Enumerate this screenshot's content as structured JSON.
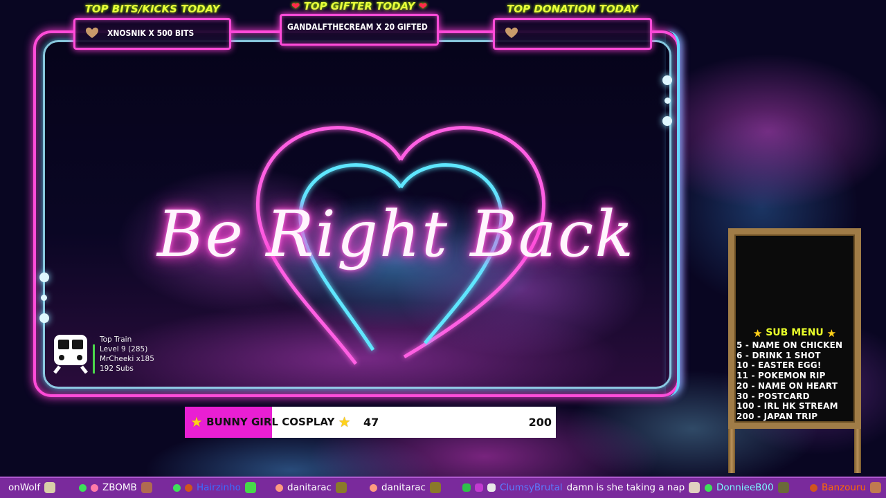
{
  "top_boxes": [
    {
      "heading": "TOP BITS/KICKS TODAY",
      "value": "XNOSNIK X 500 BITS"
    },
    {
      "heading": "TOP GIFTER TODAY",
      "value": "GANDALFTHECREAM X 20 GIFTED"
    },
    {
      "heading": "TOP DONATION TODAY",
      "value": ""
    }
  ],
  "main": {
    "title": "Be Right Back"
  },
  "train": {
    "label": "Top Train",
    "level": "Level 9  (285)",
    "user": "MrCheeki x185",
    "subs": "192 Subs"
  },
  "goal": {
    "label": "BUNNY GIRL COSPLAY",
    "current": "47",
    "target": "200",
    "progress": 0.235
  },
  "sub_menu": {
    "title": "SUB MENU",
    "items": [
      "5 - NAME ON CHICKEN",
      "6 - DRINK 1 SHOT",
      "10 - EASTER EGG!",
      "11 - POKEMON RIP",
      "20 - NAME ON HEART",
      "30 - POSTCARD",
      "100 - IRL HK STREAM",
      "200 - JAPAN TRIP"
    ]
  },
  "chat": [
    {
      "user": "onWolf",
      "color": "#ffffff",
      "message": ""
    },
    {
      "user": "ZBOMB",
      "color": "#ffffff",
      "message": ""
    },
    {
      "user": "Hairzinho",
      "color": "#3b6bff",
      "message": ""
    },
    {
      "user": "danitarac",
      "color": "#ffffff",
      "message": ""
    },
    {
      "user": "danitarac",
      "color": "#ffffff",
      "message": ""
    },
    {
      "user": "ClumsyBrutal",
      "color": "#5b7cff",
      "message": "damn is she taking a nap"
    },
    {
      "user": "DonnieeB00",
      "color": "#7cf7ff",
      "message": ""
    },
    {
      "user": "Banzouru",
      "color": "#ff6a00",
      "message": ""
    }
  ]
}
